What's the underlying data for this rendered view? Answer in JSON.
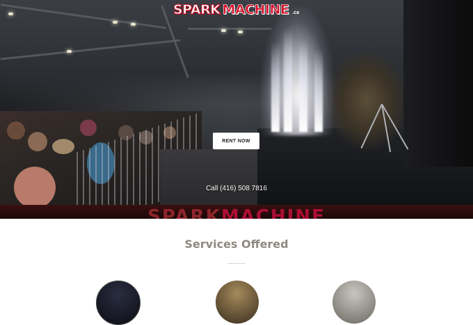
{
  "header": {
    "logo_part1": "Spark",
    "logo_part2": "Machine",
    "logo_suffix": ".ca"
  },
  "hero": {
    "rent_button": "RENT NOW",
    "phone": "Call (416) 508 7816"
  },
  "banner": {
    "text_part1": "Spark",
    "text_part2": "Machine"
  },
  "services": {
    "title": "Services Offered"
  },
  "colors": {
    "brand_red": "#d5102a",
    "title_gray": "#8e8a80"
  }
}
